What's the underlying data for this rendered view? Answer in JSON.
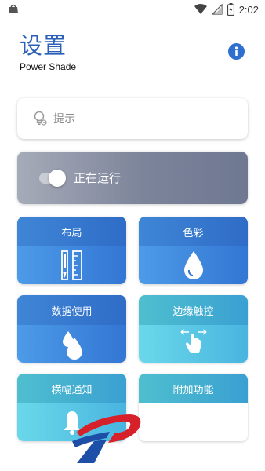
{
  "status_bar": {
    "time": "2:02",
    "left_icon": "app-notification-icon",
    "icons": [
      "wifi-icon",
      "signal-icon",
      "battery-icon"
    ]
  },
  "header": {
    "title": "设置",
    "subtitle": "Power Shade",
    "info_icon": "info-icon"
  },
  "hint": {
    "icon": "lightbulb-icon",
    "label": "提示"
  },
  "running": {
    "label": "正在运行",
    "enabled": true
  },
  "tiles": [
    {
      "label": "布局",
      "icon": "ruler-pencil-icon",
      "style": "blue"
    },
    {
      "label": "色彩",
      "icon": "drop-icon",
      "style": "blue"
    },
    {
      "label": "数据使用",
      "icon": "double-drop-icon",
      "style": "blue"
    },
    {
      "label": "边缘触控",
      "icon": "swipe-hand-icon",
      "style": "teal"
    },
    {
      "label": "横幅通知",
      "icon": "bell-icon",
      "style": "teal"
    },
    {
      "label": "附加功能",
      "icon": "puzzle-icon",
      "style": "teal"
    }
  ],
  "colors": {
    "title_blue": "#2b5fb8",
    "tile_blue": "#3f86d6",
    "tile_teal": "#4fbfcf",
    "running_gray": "#7c849a"
  }
}
